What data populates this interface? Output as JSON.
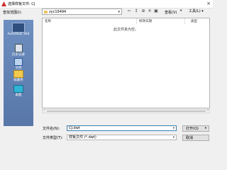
{
  "window": {
    "title": "选择样板文件: CJ"
  },
  "lookin": {
    "label": "查找范围(I):",
    "value": "zyc19494"
  },
  "toolbar": {
    "view_label": "查看(V)",
    "tools_label": "工具(L)"
  },
  "places": [
    {
      "label": "Autodesk 360"
    },
    {
      "label": "历史记录"
    },
    {
      "label": "文档"
    },
    {
      "label": "收藏夹"
    },
    {
      "label": "桌面"
    }
  ],
  "filelist": {
    "columns": [
      "名称",
      "修改日期",
      "类型"
    ],
    "empty_message": "此文件夹为空。"
  },
  "filename": {
    "label": "文件名(N):",
    "value": "CJ.dwt"
  },
  "filetype": {
    "label": "文件类型(T):",
    "value": "样板文件 (*.dwt)"
  },
  "buttons": {
    "open": "打开(O)",
    "cancel": "取消"
  },
  "colors": {
    "places_bg": "#6d8fc0",
    "accent": "#3c7fb1"
  }
}
